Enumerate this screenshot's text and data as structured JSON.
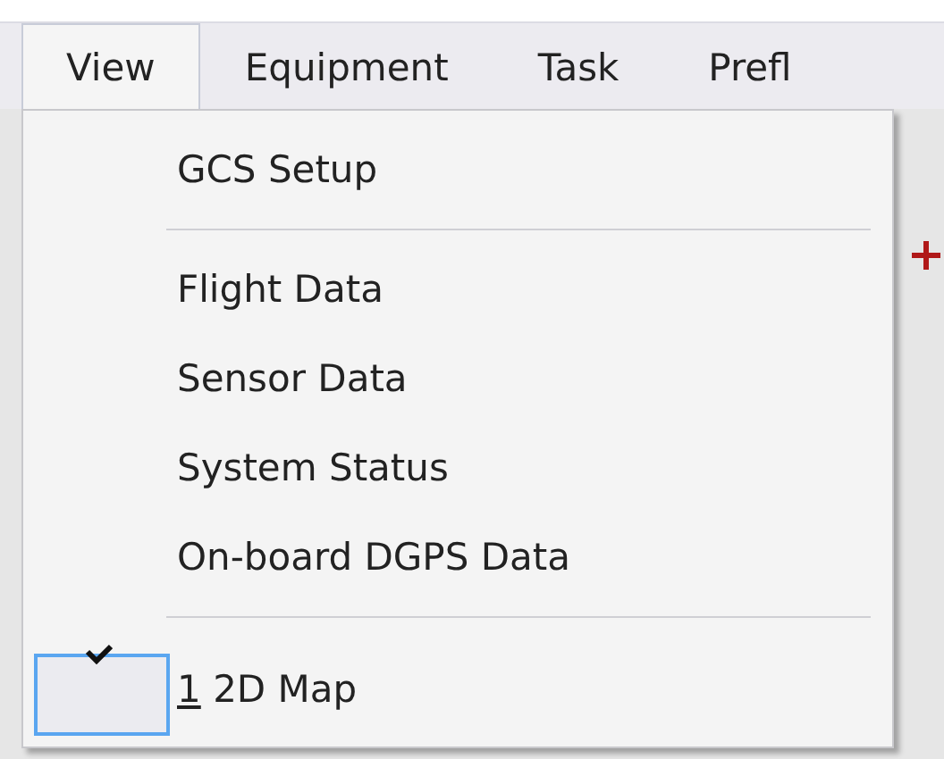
{
  "menu_bar": [
    {
      "label": "View",
      "selected": true
    },
    {
      "label": "Equipment",
      "selected": false
    },
    {
      "label": "Task",
      "selected": false
    },
    {
      "label": "Prefl",
      "selected": false
    }
  ],
  "dropdown": [
    {
      "kind": "item",
      "label": "GCS Setup",
      "checked": false
    },
    {
      "kind": "separator"
    },
    {
      "kind": "item",
      "label": "Flight Data",
      "checked": false
    },
    {
      "kind": "item",
      "label": "Sensor Data",
      "checked": false
    },
    {
      "kind": "item",
      "label": "System Status",
      "checked": false
    },
    {
      "kind": "item",
      "label": "On-board DGPS Data",
      "checked": false
    },
    {
      "kind": "separator"
    },
    {
      "kind": "item",
      "accelerator": "1",
      "label": "2D Map",
      "checked": true
    }
  ]
}
